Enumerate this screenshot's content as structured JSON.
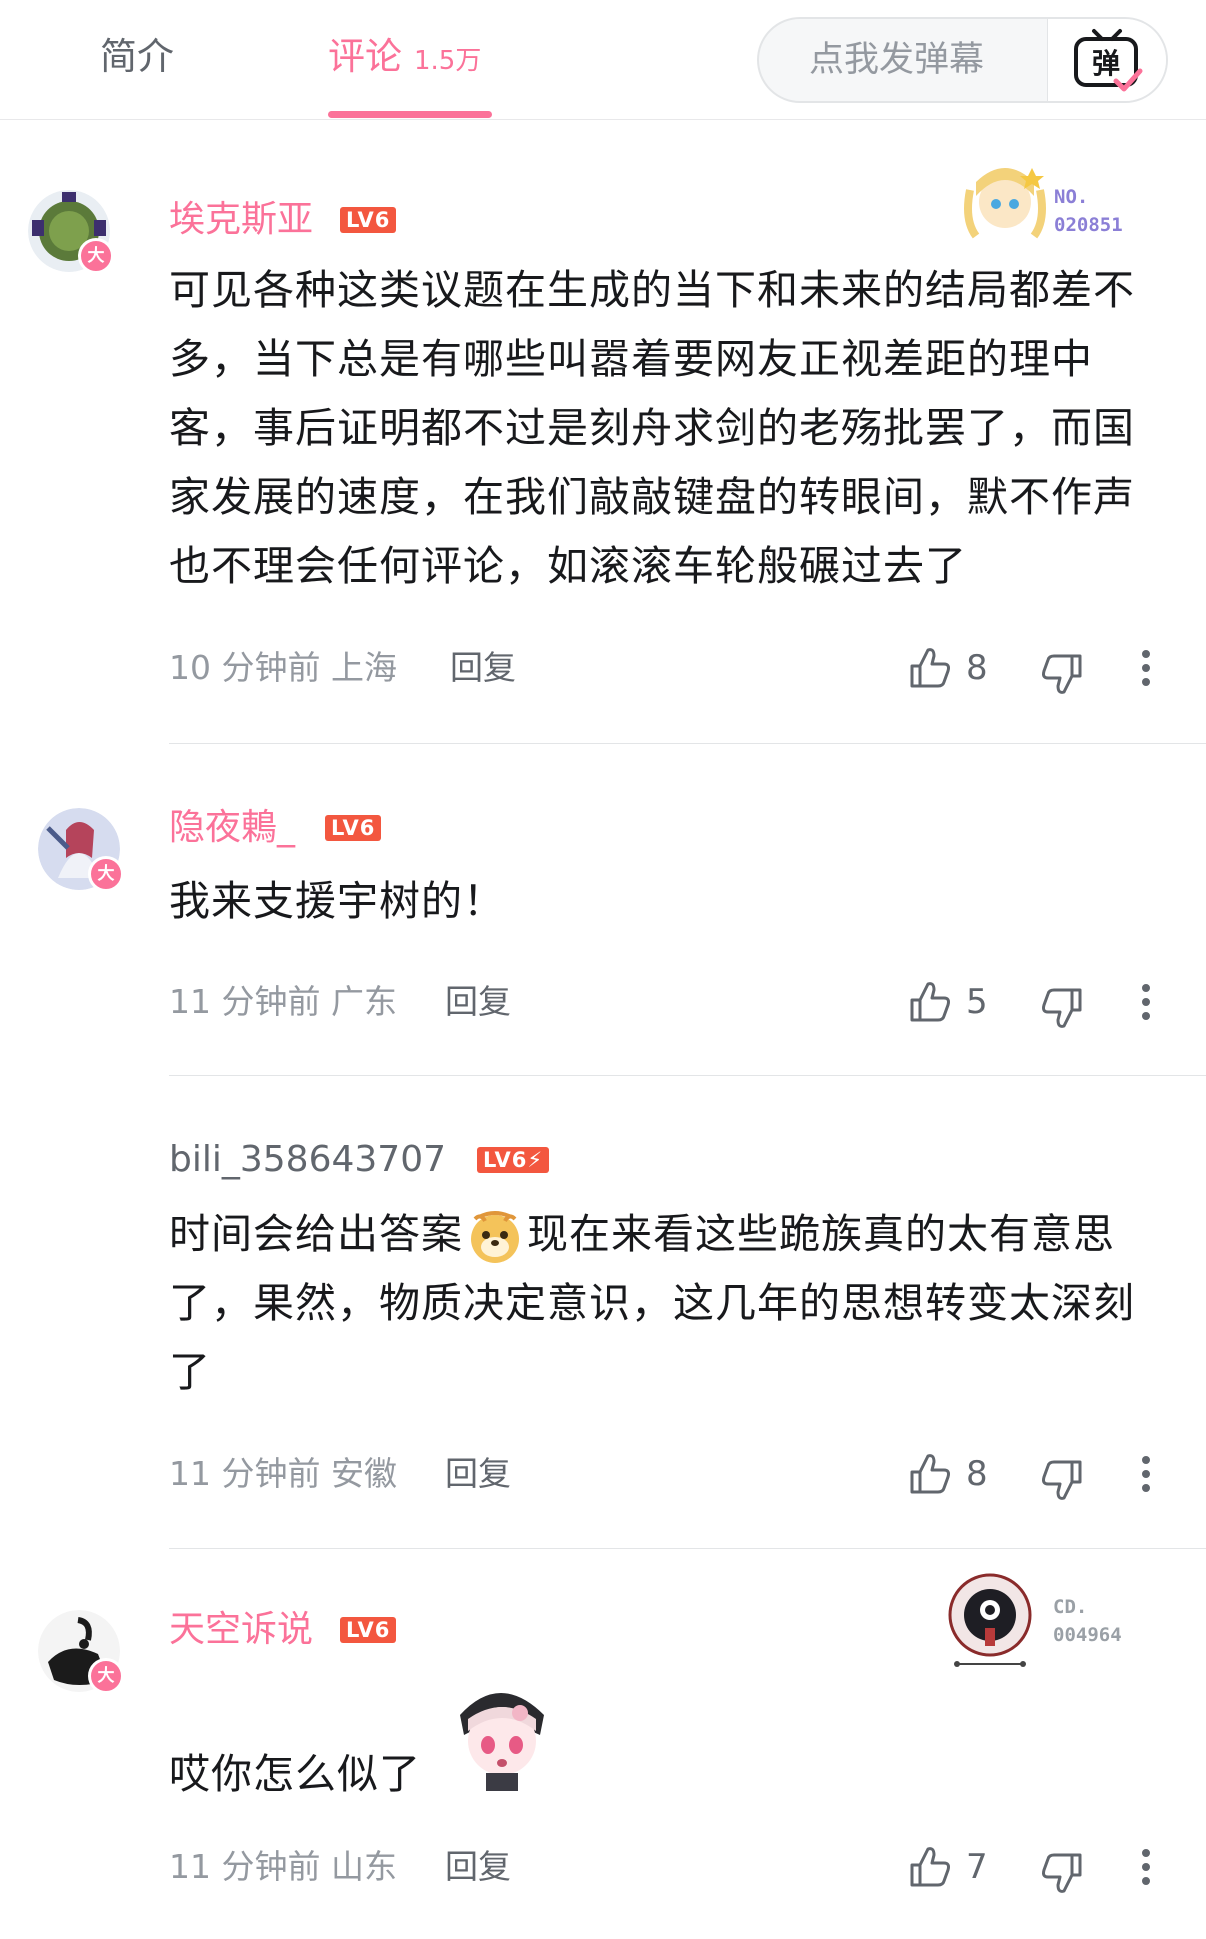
{
  "tabs": {
    "intro": "简介",
    "comments": "评论",
    "comment_count": "1.5万"
  },
  "danmaku": {
    "placeholder": "点我发弹幕",
    "button_glyph": "弹"
  },
  "colors": {
    "accent": "#fb7299",
    "level_badge": "#f3573f",
    "muted": "#9499a0"
  },
  "comments": [
    {
      "username": "埃克斯亚",
      "level": "LV6",
      "vip_badge": "大",
      "fan_badge_no": "NO.",
      "fan_badge_id": "020851",
      "content": "可见各种这类议题在生成的当下和未来的结局都差不多，当下总是有哪些叫嚣着要网友正视差距的理中客，事后证明都不过是刻舟求剑的老殇批罢了，而国家发展的速度，在我们敲敲键盘的转眼间，默不作声也不理会任何评论，如滚滚车轮般碾过去了",
      "time": "10 分钟前",
      "location": "上海",
      "reply": "回复",
      "likes": "8"
    },
    {
      "username": "隐夜鶇_",
      "level": "LV6",
      "vip_badge": "大",
      "content": "我来支援宇树的！",
      "time": "11 分钟前",
      "location": "广东",
      "reply": "回复",
      "likes": "5"
    },
    {
      "username": "bili_358643707",
      "level": "LV6",
      "content_before_emoji": "时间会给出答案",
      "emoji": "doge-emoji",
      "content_after_emoji": "现在来看这些跪族真的太有意思了，果然，物质决定意识，这几年的思想转变太深刻了",
      "time": "11 分钟前",
      "location": "安徽",
      "reply": "回复",
      "likes": "8"
    },
    {
      "username": "天空诉说",
      "level": "LV6",
      "vip_badge": "大",
      "fan_badge_no": "CD.",
      "fan_badge_id": "004964",
      "content": "哎你怎么似了",
      "sticker": "anime-girl-sticker",
      "time": "11 分钟前",
      "location": "山东",
      "reply": "回复",
      "likes": "7"
    }
  ]
}
